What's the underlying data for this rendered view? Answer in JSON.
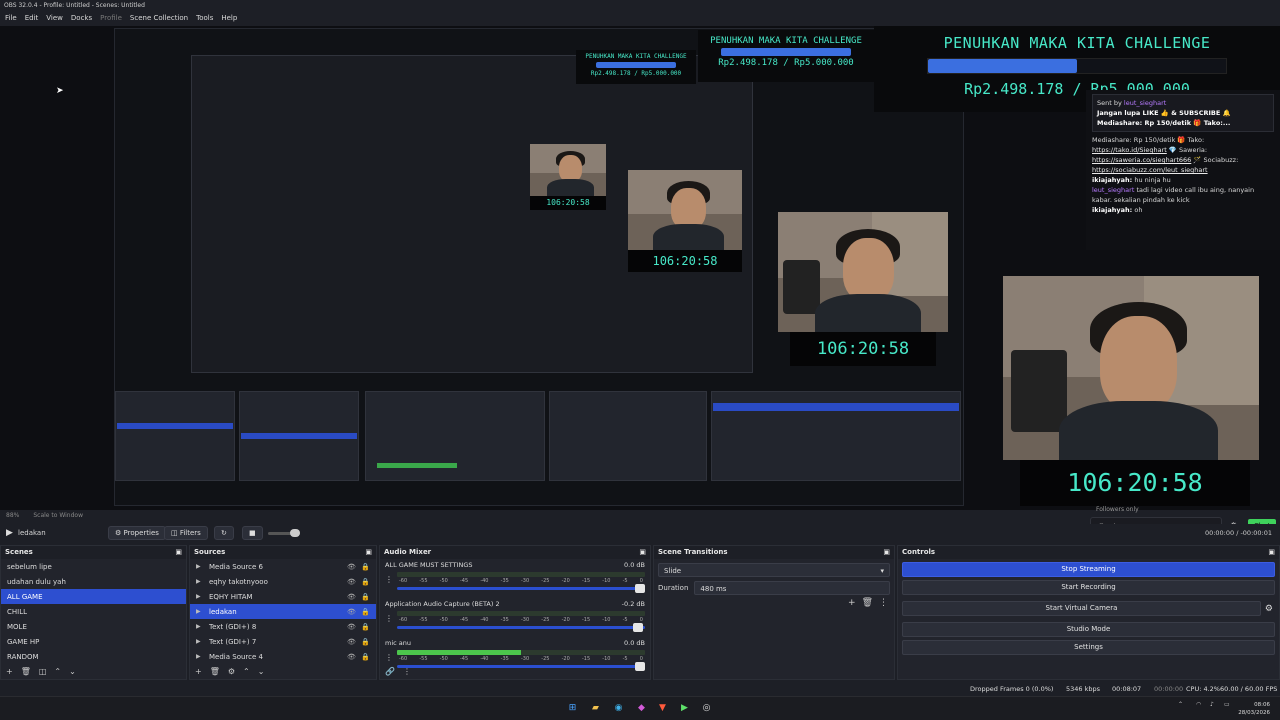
{
  "window": {
    "title": "OBS 32.0.4 - Profile: Untitled - Scenes: Untitled"
  },
  "menu": [
    "File",
    "Edit",
    "View",
    "Docks",
    "Profile",
    "Scene Collection",
    "Tools",
    "Help"
  ],
  "overlay": {
    "challenge_title": "PENUHKAN MAKA KITA CHALLENGE",
    "progress_fraction": 0.4996,
    "amount": "Rp2.498.178 / Rp5.000.000",
    "timer": "106:20:58"
  },
  "chat": {
    "sender": "Sent by",
    "sender_name": "leut_sieghart",
    "pinned_line1": "Jangan lupa LIKE 👍 & SUBSCRIBE 🔔",
    "pinned_line2": "Mediashare: Rp 150/detik 🎁 Tako:...",
    "msg1": "Mediashare: Rp 150/detik 🎁 Tako:",
    "link1": "https://tako.id/Sieghart",
    "saweria_label": "💎 Saweria:",
    "link2": "https://saweria.co/sieghart666",
    "sociabuzz_label": "🪄 Sociabuzz:",
    "link3": "https://sociabuzz.com/leut_sieghart",
    "msg2_user": "ikiajahyah:",
    "msg2_text": "hu ninja hu",
    "msg3_user": "leut_sieghart",
    "msg3_text": "tadi lagi video call ibu aing, nanyain kabar. sekalian pindah ke kick",
    "msg4_user": "ikiajahyah:",
    "msg4_text": "oh",
    "followers": "Followers only",
    "input_placeholder": "Send a message",
    "chat_button": "Chat"
  },
  "preview": {
    "zoom": "88%",
    "scale_mode": "Scale to Window"
  },
  "mediabar": {
    "source": "ledakan",
    "properties": "Properties",
    "filters": "Filters",
    "time": "00:00:00 / -00:00:01"
  },
  "docks": {
    "scenes": {
      "title": "Scenes",
      "items": [
        "sebelum lipe",
        "udahan dulu yah",
        "ALL GAME",
        "CHILL",
        "MOLE",
        "GAME HP",
        "RANDOM"
      ],
      "selected": 2
    },
    "sources": {
      "title": "Sources",
      "items": [
        "Media Source 6",
        "eqhy takotnyooo",
        "EQHY HITAM",
        "ledakan",
        "Text (GDI+) 8",
        "Text (GDI+) 7",
        "Media Source 4"
      ],
      "selected": 3
    },
    "mixer": {
      "title": "Audio Mixer",
      "channels": [
        {
          "name": "ALL GAME MUST SETTINGS",
          "db": "0.0 dB",
          "level": 0.0,
          "volume": 1.0
        },
        {
          "name": "Application Audio Capture (BETA) 2",
          "db": "-0.2 dB",
          "level": 0.0,
          "volume": 0.99
        },
        {
          "name": "mic anu",
          "db": "0.0 dB",
          "level": 0.5,
          "volume": 1.0
        }
      ],
      "scale": [
        "-60",
        "-55",
        "-50",
        "-45",
        "-40",
        "-35",
        "-30",
        "-25",
        "-20",
        "-15",
        "-10",
        "-5",
        "0"
      ]
    },
    "transitions": {
      "title": "Scene Transitions",
      "transition": "Slide",
      "duration_label": "Duration",
      "duration": "480 ms"
    },
    "controls": {
      "title": "Controls",
      "buttons": [
        "Stop Streaming",
        "Start Recording",
        "Start Virtual Camera",
        "Studio Mode",
        "Settings"
      ]
    }
  },
  "status": {
    "dropped": "Dropped Frames 0 (0.0%)",
    "kbps": "5346 kbps",
    "stream_time": "00:08:07",
    "rec_time": "00:00:00",
    "cpu": "CPU: 4.2%",
    "fps": "60.00 / 60.00 FPS"
  },
  "clock": {
    "time": "08:06",
    "date": "28/03/2026"
  },
  "colors": {
    "accent": "#2d4fd0",
    "overlay_text": "#47e8c8",
    "chat_green": "#3fd25c"
  }
}
